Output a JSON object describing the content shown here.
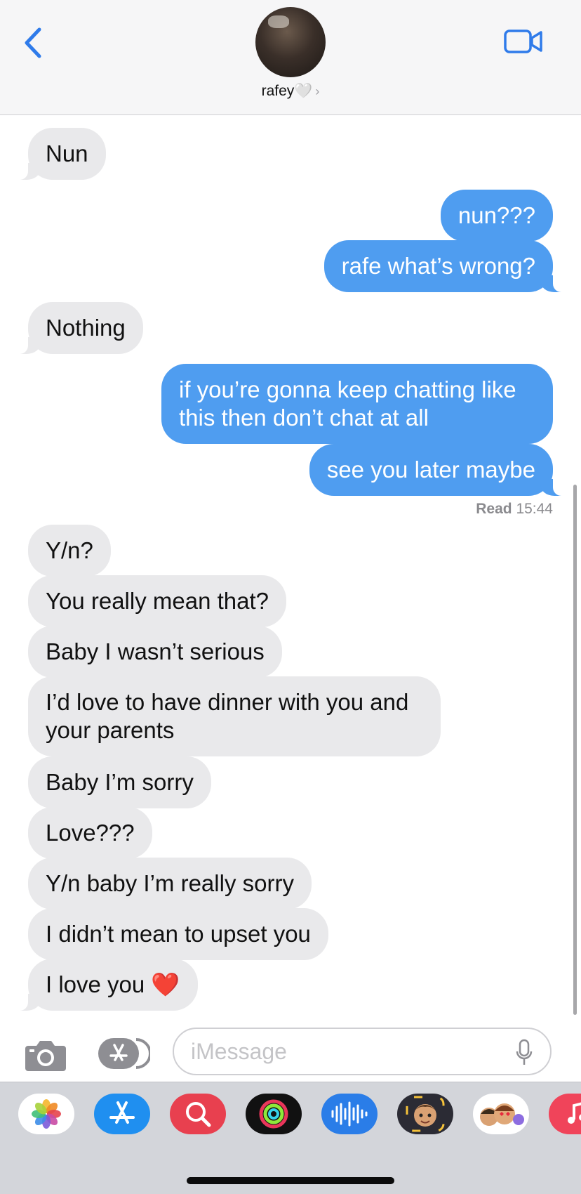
{
  "header": {
    "contact_name": "rafey",
    "heart": "🤍",
    "chevron": "›"
  },
  "messages": [
    {
      "from": "them",
      "text": "Nun"
    },
    {
      "from": "me",
      "text": "nun???"
    },
    {
      "from": "me",
      "text": "rafe what’s wrong?"
    },
    {
      "from": "them",
      "text": "Nothing"
    },
    {
      "from": "me",
      "text": "if you’re gonna keep chatting like this then don’t chat at all"
    },
    {
      "from": "me",
      "text": "see you later maybe"
    },
    {
      "from": "them",
      "text": "Y/n?"
    },
    {
      "from": "them",
      "text": "You really mean that?"
    },
    {
      "from": "them",
      "text": "Baby I wasn’t serious"
    },
    {
      "from": "them",
      "text": "I’d love to have dinner with you and your parents"
    },
    {
      "from": "them",
      "text": "Baby I’m sorry"
    },
    {
      "from": "them",
      "text": "Love???"
    },
    {
      "from": "them",
      "text": "Y/n baby I’m really sorry"
    },
    {
      "from": "them",
      "text": "I didn’t mean to upset you"
    },
    {
      "from": "them",
      "text": "I love you ❤️"
    }
  ],
  "receipt": {
    "label": "Read",
    "time": "15:44"
  },
  "composer": {
    "placeholder": "iMessage"
  },
  "app_drawer": [
    "photos-app",
    "app-store",
    "images-search",
    "activity",
    "audio-message",
    "memoji",
    "memoji-stickers",
    "music"
  ],
  "colors": {
    "outgoing_bubble": "#4f9df0",
    "incoming_bubble": "#e9e9eb",
    "accent": "#2f7bea"
  }
}
